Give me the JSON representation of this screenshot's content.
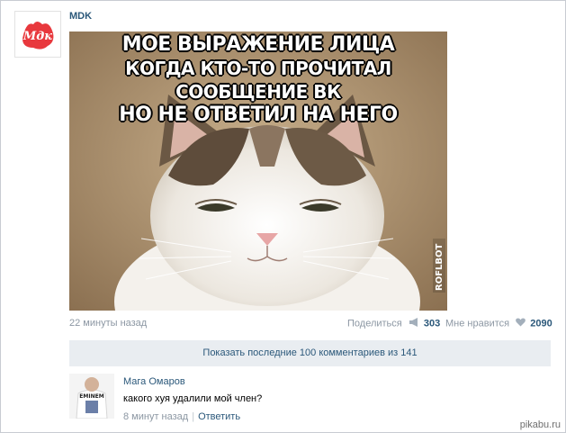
{
  "post": {
    "author": "MDK",
    "avatar_text": "Mдк",
    "meme_lines": [
      "МОЕ ВЫРАЖЕНИЕ ЛИЦА",
      "КОГДА КТО-ТО ПРОЧИТАЛ СООБЩЕНИЕ ВК",
      "НО НЕ ОТВЕТИЛ НА НЕГО"
    ],
    "watermark": "ROFLBOT",
    "time": "22 минуты назад",
    "share_label": "Поделиться",
    "share_icon": "megaphone-icon",
    "share_count": "303",
    "like_label": "Мне нравится",
    "like_icon": "heart-icon",
    "like_count": "2090"
  },
  "comments": {
    "show_more": "Показать последние 100 комментариев из 141",
    "items": [
      {
        "author": "Мага Омаров",
        "avatar_text": "EMINEM",
        "text": "какого хуя удалили мой член?",
        "time": "8 минут назад",
        "separator": "|",
        "reply": "Ответить"
      }
    ]
  },
  "watermark_site": "pikabu.ru",
  "colors": {
    "link": "#2b587a",
    "muted": "#8c97a3",
    "bar": "#e9edf1"
  }
}
